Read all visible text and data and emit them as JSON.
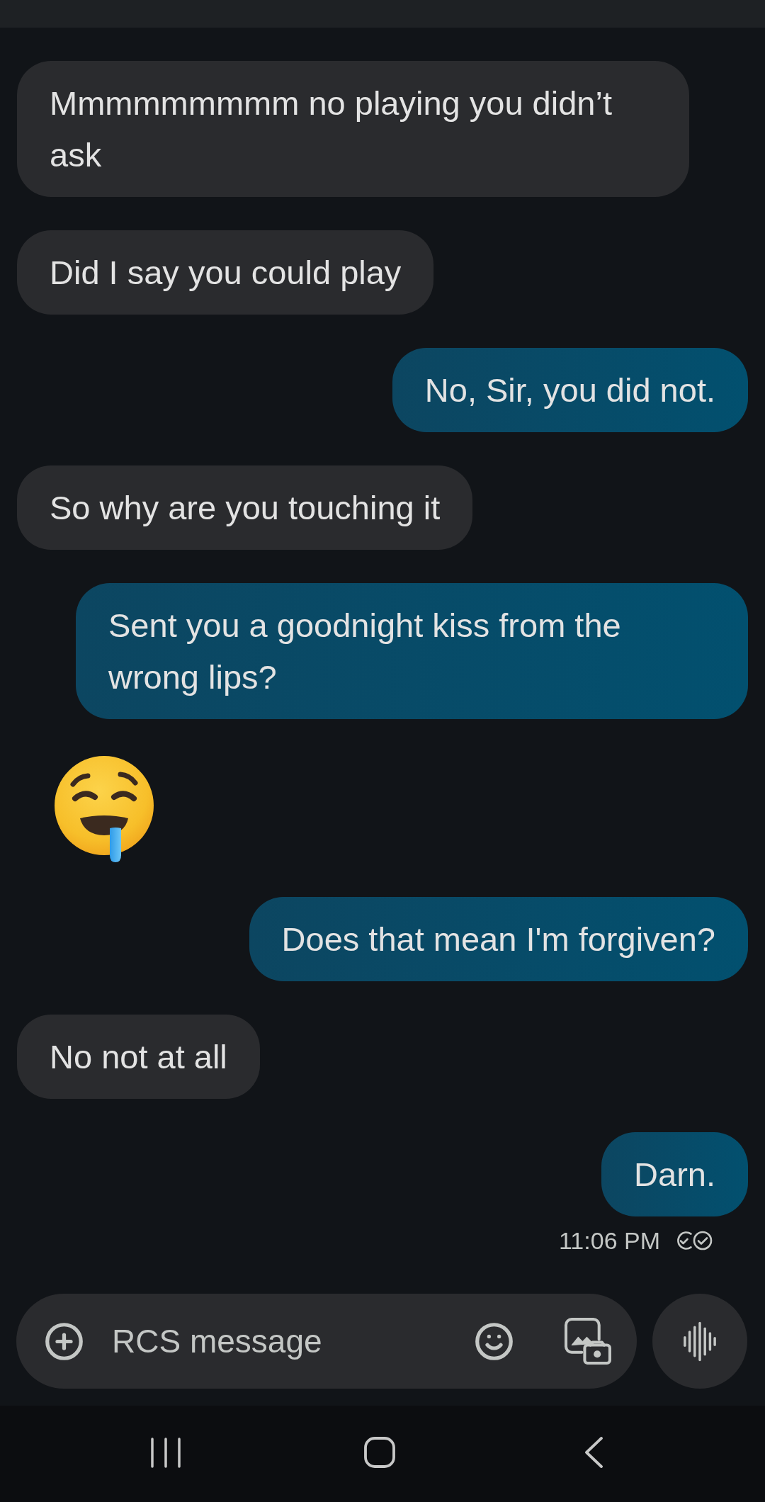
{
  "messages": [
    {
      "kind": "received",
      "text": "Mmmmmmmmm no playing you didn’t ask"
    },
    {
      "kind": "received",
      "text": "Did I say you could play"
    },
    {
      "kind": "sent",
      "text": "No, Sir, you did not."
    },
    {
      "kind": "received",
      "text": "So why are you touching it"
    },
    {
      "kind": "sent",
      "text": "Sent you a goodnight kiss from the wrong lips?"
    },
    {
      "kind": "emoji"
    },
    {
      "kind": "sent",
      "text": "Does that mean I'm forgiven?"
    },
    {
      "kind": "received",
      "text": "No not at all"
    },
    {
      "kind": "sent",
      "text": "Darn."
    }
  ],
  "last_message_status": {
    "time": "11:06 PM",
    "read": true
  },
  "compose": {
    "placeholder": "RCS message"
  }
}
